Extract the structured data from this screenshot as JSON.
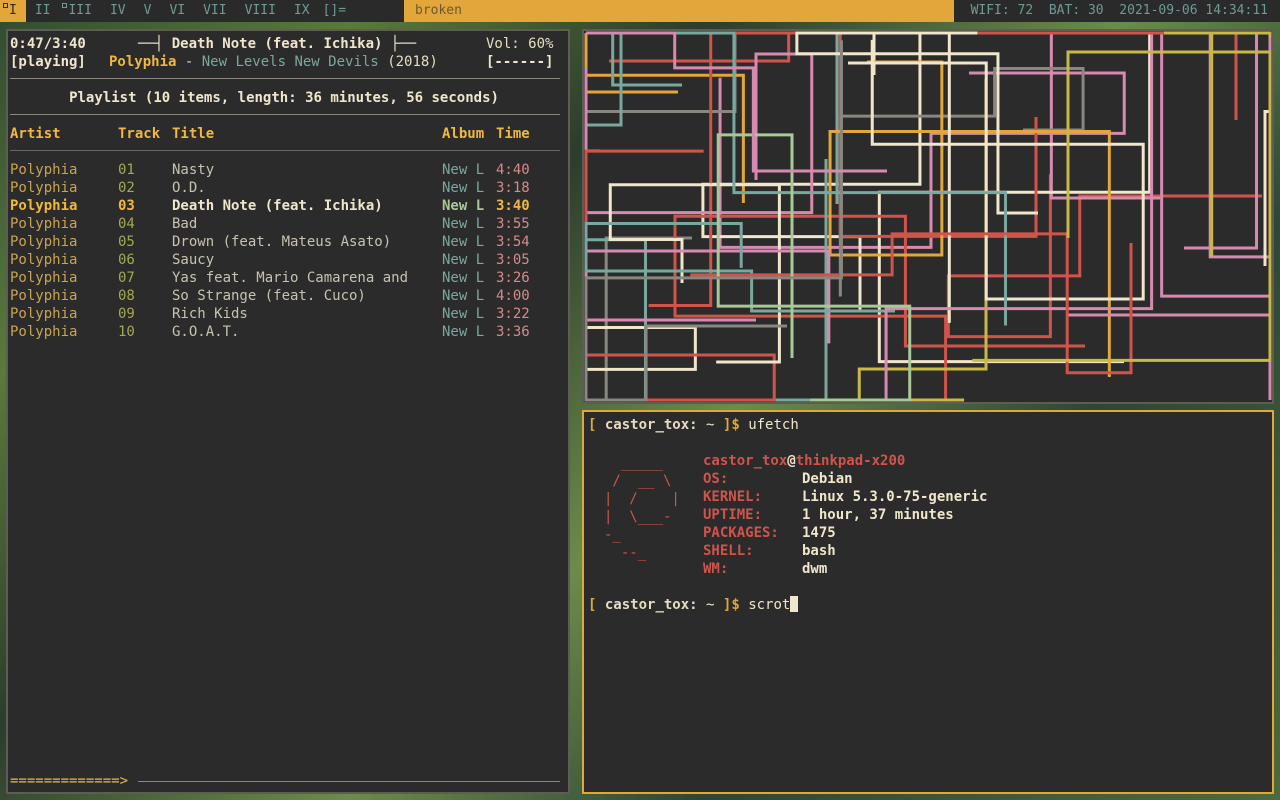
{
  "bar": {
    "tags": [
      "I",
      "II",
      "III",
      "IV",
      "V",
      "VI",
      "VII",
      "VIII",
      "IX"
    ],
    "active_tag": 0,
    "occupied_tags": [
      0,
      2
    ],
    "layout_symbol": "[]=",
    "window_title": "broken",
    "status": "WIFI: 72  BAT: 30  2021-09-06 14:34:11"
  },
  "ncmpcpp": {
    "elapsed_total": "0:47/3:40",
    "now_playing_title": "Death Note (feat. Ichika)",
    "title_left_deco": "──┤",
    "title_right_deco": "├──",
    "volume": "Vol: 60%",
    "state": "[playing]",
    "artist": "Polyphia",
    "separator": " - ",
    "album": "New Levels New Devils",
    "year": "(2018)",
    "flags": "[------]",
    "playlist_summary": "Playlist (10 items, length: 36 minutes, 56 seconds)",
    "columns": {
      "artist": "Artist",
      "track": "Track",
      "title": "Title",
      "album": "Album",
      "time": "Time"
    },
    "current_index": 2,
    "tracks": [
      {
        "artist": "Polyphia",
        "track": "01",
        "title": "Nasty",
        "album": "New L",
        "time": "4:40"
      },
      {
        "artist": "Polyphia",
        "track": "02",
        "title": "O.D.",
        "album": "New L",
        "time": "3:18"
      },
      {
        "artist": "Polyphia",
        "track": "03",
        "title": "Death Note (feat. Ichika)",
        "album": "New L",
        "time": "3:40"
      },
      {
        "artist": "Polyphia",
        "track": "04",
        "title": "Bad",
        "album": "New L",
        "time": "3:55"
      },
      {
        "artist": "Polyphia",
        "track": "05",
        "title": "Drown (feat. Mateus Asato)",
        "album": "New L",
        "time": "3:54"
      },
      {
        "artist": "Polyphia",
        "track": "06",
        "title": "Saucy",
        "album": "New L",
        "time": "3:05"
      },
      {
        "artist": "Polyphia",
        "track": "07",
        "title": "Yas feat. Mario Camarena and",
        "album": "New L",
        "time": "3:26"
      },
      {
        "artist": "Polyphia",
        "track": "08",
        "title": "So Strange (feat. Cuco)",
        "album": "New L",
        "time": "4:00"
      },
      {
        "artist": "Polyphia",
        "track": "09",
        "title": "Rich Kids",
        "album": "New L",
        "time": "3:22"
      },
      {
        "artist": "Polyphia",
        "track": "10",
        "title": "G.O.A.T.",
        "album": "New L",
        "time": "3:36"
      }
    ],
    "progress_text": "=============>",
    "progress_fraction": 0.2136
  },
  "terminal": {
    "prompt_open": "[",
    "prompt_user": "castor_tox:",
    "prompt_path": "~",
    "prompt_close": "]$",
    "command1": "ufetch",
    "logo_lines": [
      "  _____",
      " /  __ \\",
      "|  /    |",
      "|  \\___-",
      "-_",
      "  --_"
    ],
    "user": "castor_tox",
    "at": "@",
    "host": "thinkpad-x200",
    "info": [
      {
        "key": "OS:",
        "value": "Debian"
      },
      {
        "key": "KERNEL:",
        "value": "Linux 5.3.0-75-generic"
      },
      {
        "key": "UPTIME:",
        "value": "1 hour, 37 minutes"
      },
      {
        "key": "PACKAGES:",
        "value": "1475"
      },
      {
        "key": "SHELL:",
        "value": "bash"
      },
      {
        "key": "WM:",
        "value": "dwm"
      }
    ],
    "command2": "scrot"
  },
  "pipes_colors": [
    "#79a89e",
    "#d0544a",
    "#c8b84a",
    "#d68ab0",
    "#f0e6cc",
    "#8a8680",
    "#e2a63a",
    "#a6c995"
  ]
}
